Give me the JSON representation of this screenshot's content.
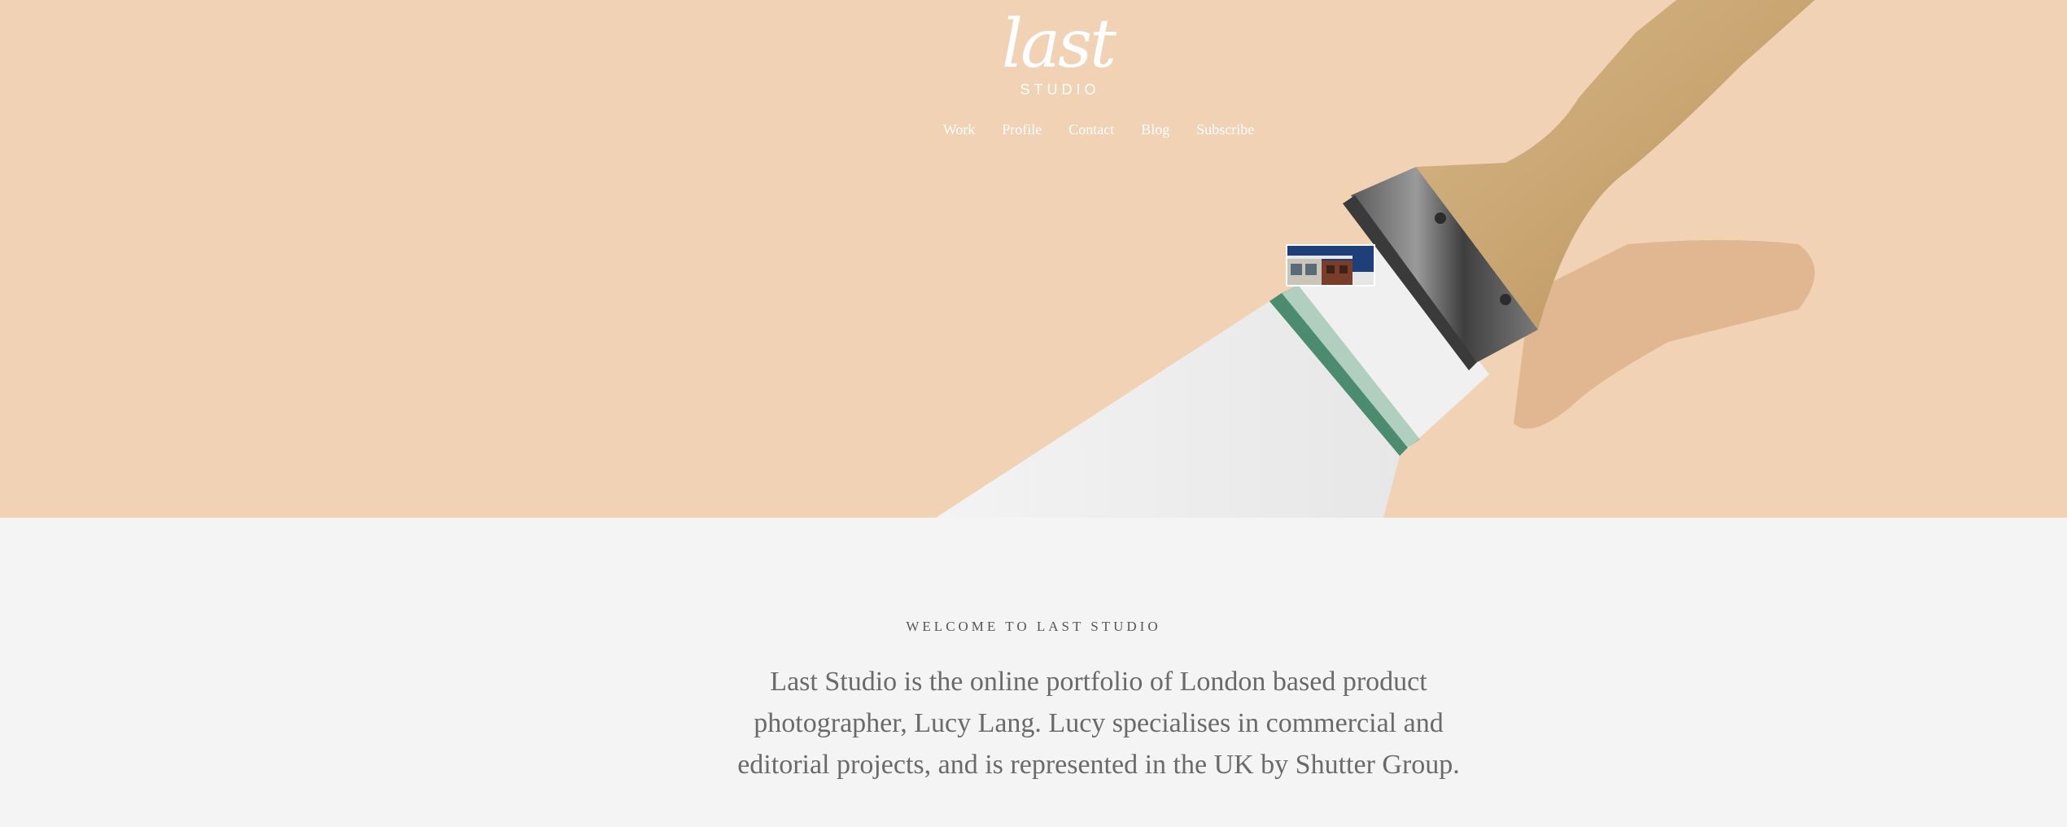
{
  "brand": {
    "logo_script": "last",
    "logo_sub": "STUDIO"
  },
  "nav": {
    "items": [
      {
        "label": "Work"
      },
      {
        "label": "Profile"
      },
      {
        "label": "Contact"
      },
      {
        "label": "Blog"
      },
      {
        "label": "Subscribe"
      }
    ]
  },
  "hero": {
    "background_color": "#f1d2b4",
    "image_subject": "paintbrush painting a white stroke",
    "thumbnail_subject": "building"
  },
  "intro": {
    "eyebrow": "WELCOME TO LAST STUDIO",
    "text": "Last Studio is the online portfolio of London based product photographer, Lucy Lang. Lucy specialises in commercial and editorial projects, and is represented in the UK by Shutter Group."
  },
  "colors": {
    "hero_bg": "#f1d2b4",
    "page_bg": "#f4f4f4",
    "text": "#6a6a6a",
    "nav_text": "#ffffff"
  }
}
